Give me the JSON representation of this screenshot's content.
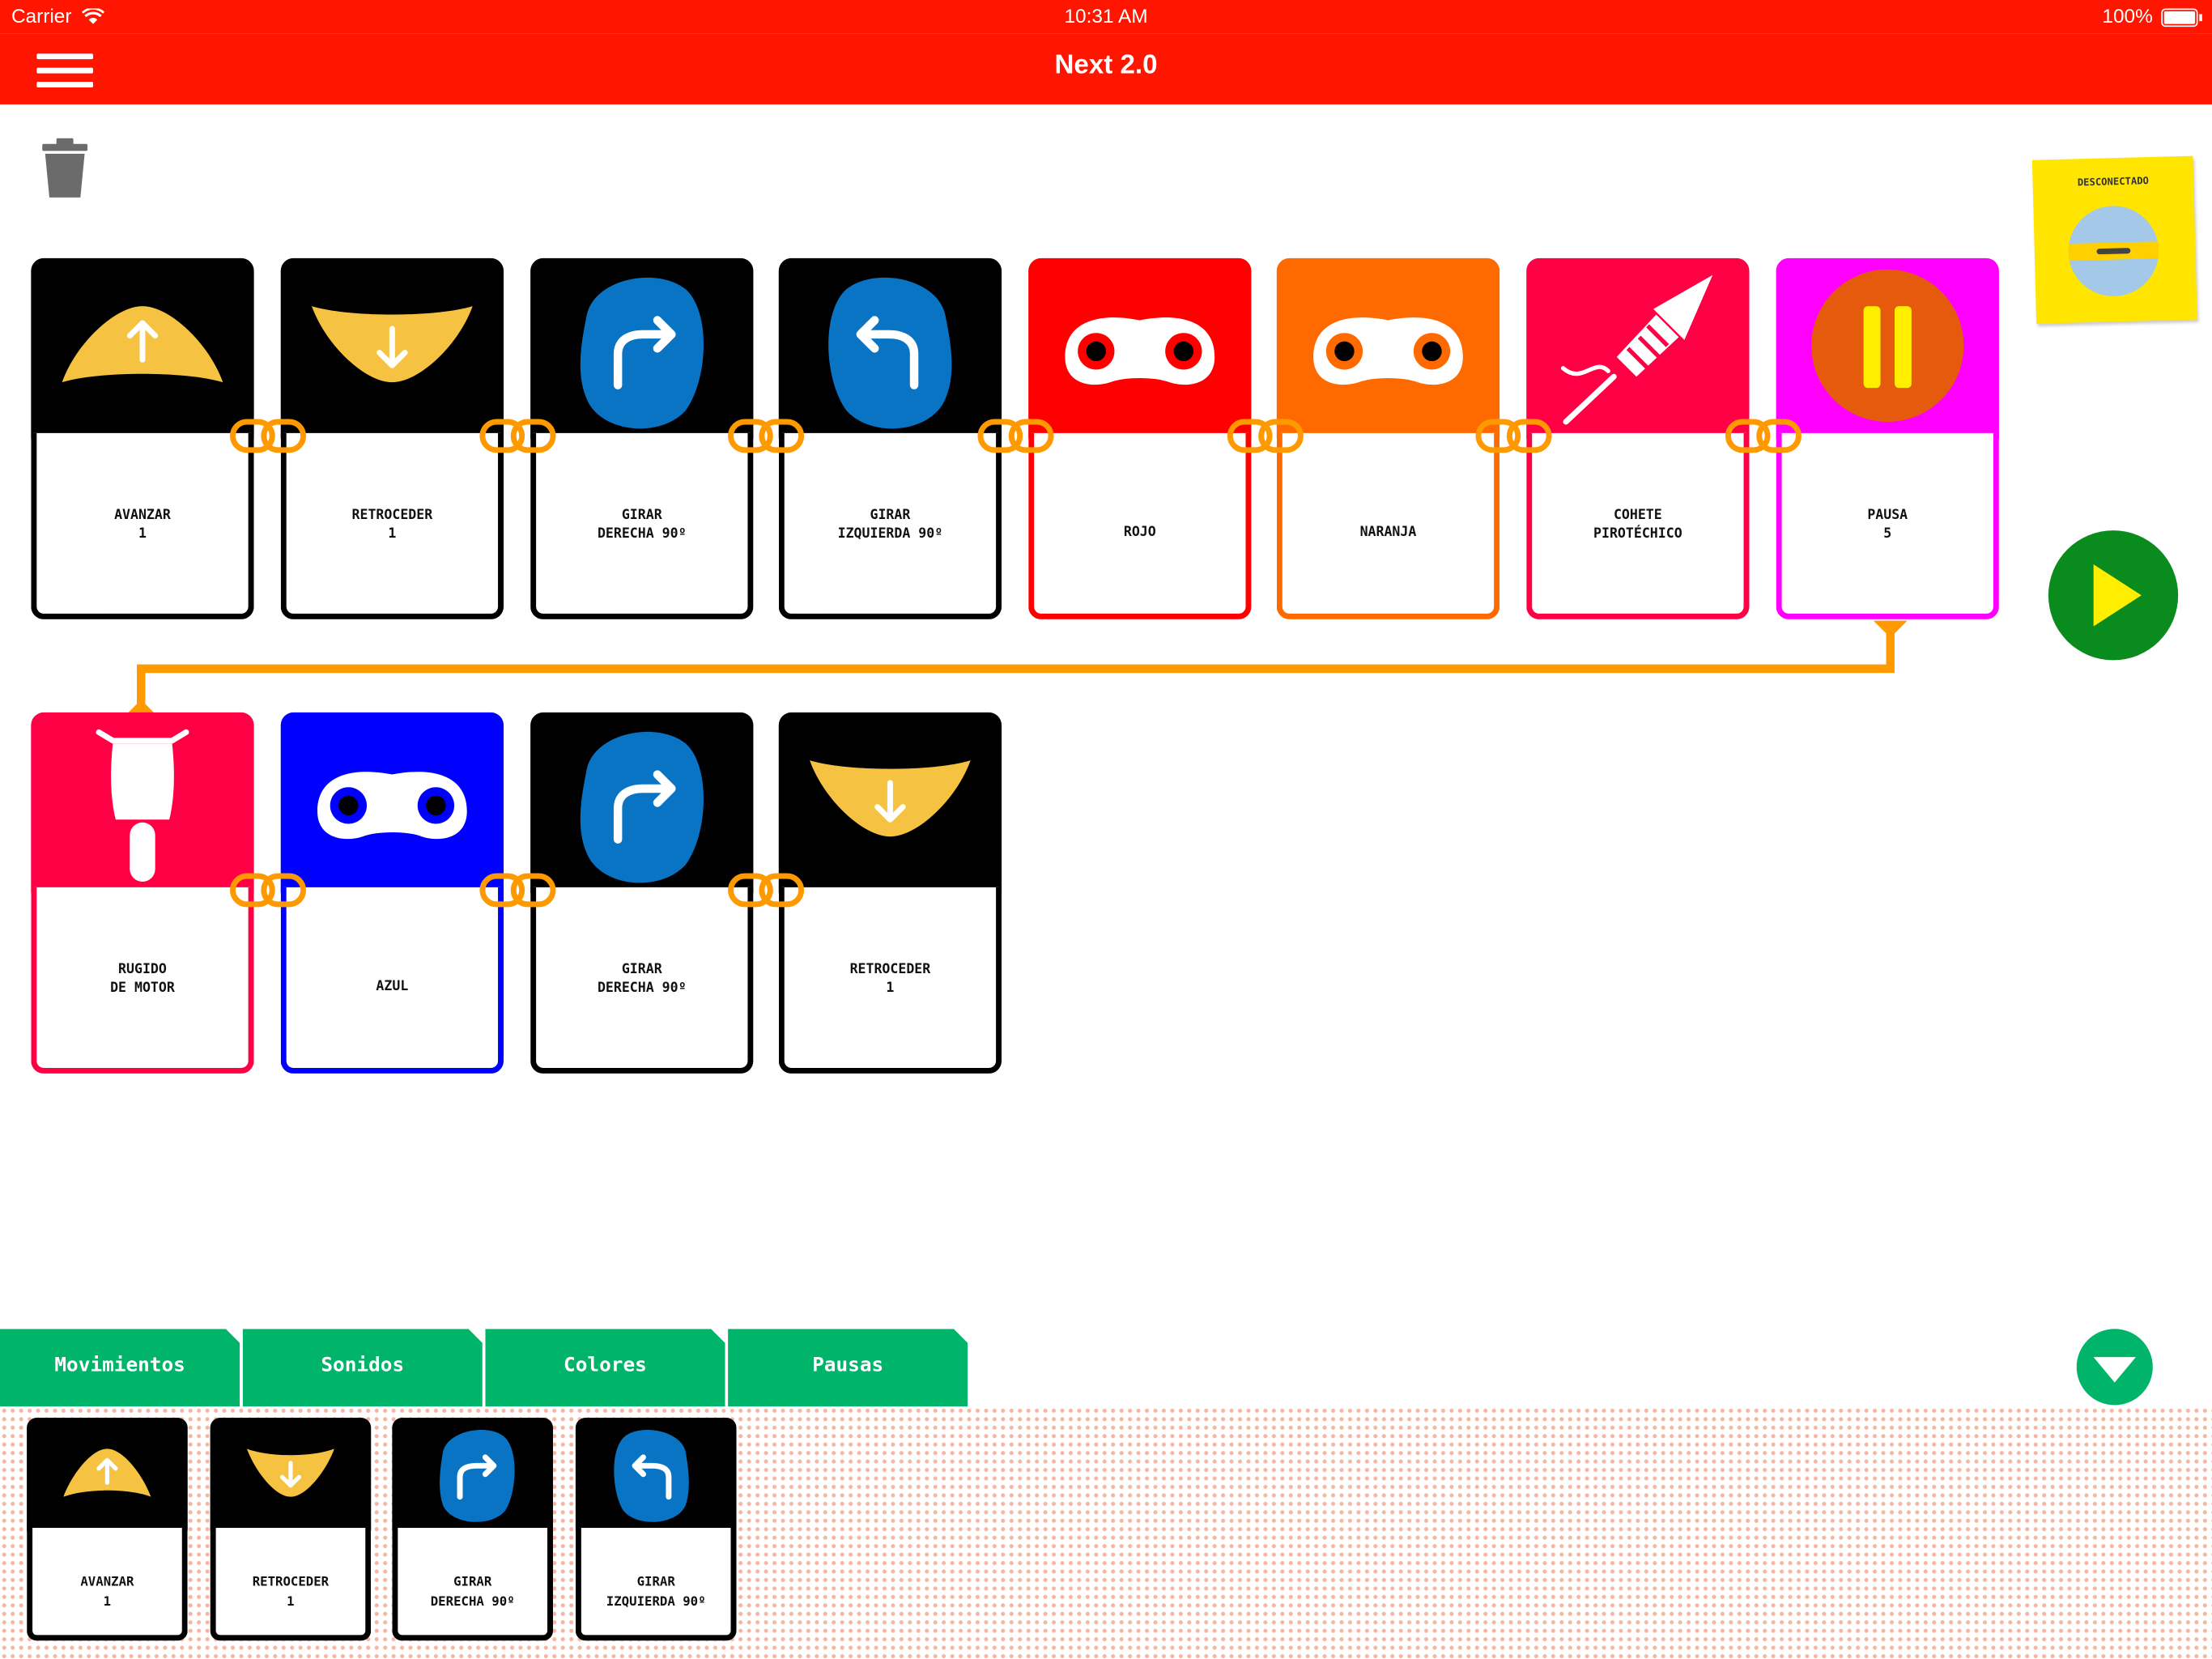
{
  "status_bar": {
    "carrier": "Carrier",
    "time": "10:31 AM",
    "battery": "100%"
  },
  "nav": {
    "title": "Next 2.0"
  },
  "device": {
    "status": "DESCONECTADO"
  },
  "program": {
    "row1": [
      {
        "line1": "AVANZAR",
        "line2": "1",
        "icon": "arrow-up-icon"
      },
      {
        "line1": "RETROCEDER",
        "line2": "1",
        "icon": "arrow-down-icon"
      },
      {
        "line1": "GIRAR",
        "line2": "DERECHA 90º",
        "icon": "turn-right-icon"
      },
      {
        "line1": "GIRAR",
        "line2": "IZQUIERDA 90º",
        "icon": "turn-left-icon"
      },
      {
        "line1": "ROJO",
        "line2": "",
        "icon": "red-eyes-icon"
      },
      {
        "line1": "NARANJA",
        "line2": "",
        "icon": "orange-eyes-icon"
      },
      {
        "line1": "COHETE",
        "line2": "PIROTÉCHICO",
        "icon": "rocket-icon"
      },
      {
        "line1": "PAUSA",
        "line2": "5",
        "icon": "pause-icon"
      }
    ],
    "row2": [
      {
        "line1": "RUGIDO",
        "line2": "DE MOTOR",
        "icon": "motorbike-icon"
      },
      {
        "line1": "AZUL",
        "line2": "",
        "icon": "blue-eyes-icon"
      },
      {
        "line1": "GIRAR",
        "line2": "DERECHA 90º",
        "icon": "turn-right-icon"
      },
      {
        "line1": "RETROCEDER",
        "line2": "1",
        "icon": "arrow-down-icon"
      }
    ]
  },
  "tabs": [
    "Movimientos",
    "Sonidos",
    "Colores",
    "Pausas"
  ],
  "palette": [
    {
      "line1": "AVANZAR",
      "line2": "1",
      "icon": "arrow-up-icon"
    },
    {
      "line1": "RETROCEDER",
      "line2": "1",
      "icon": "arrow-down-icon"
    },
    {
      "line1": "GIRAR",
      "line2": "DERECHA 90º",
      "icon": "turn-right-icon"
    },
    {
      "line1": "GIRAR",
      "line2": "IZQUIERDA 90º",
      "icon": "turn-left-icon"
    }
  ],
  "colors": {
    "nav": "#ff1500",
    "black": "#000000",
    "red": "#ff0000",
    "orange": "#ff6a00",
    "crimson": "#ff0044",
    "magenta": "#ff00ff",
    "blue": "#0000ff",
    "green": "#00b46a",
    "link": "#ff9900",
    "yellow": "#f5c242",
    "turn_blue": "#0a74c4"
  }
}
